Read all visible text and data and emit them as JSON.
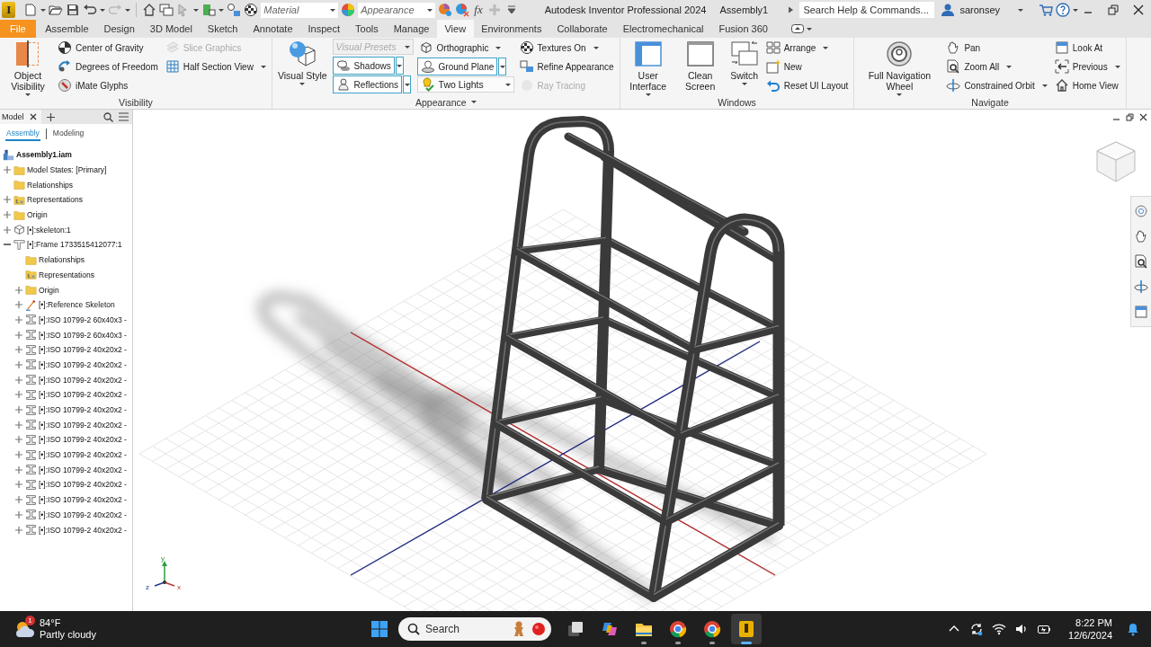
{
  "title_bar": {
    "app_letter": "I",
    "material": {
      "placeholder": "Material"
    },
    "appearance": {
      "placeholder": "Appearance"
    },
    "fx_label": "fx",
    "title": "Autodesk Inventor Professional 2024",
    "document": "Assembly1",
    "search": {
      "placeholder": "Search Help & Commands..."
    },
    "user": "saronsey"
  },
  "ribbon_tabs": [
    {
      "label": "File",
      "kind": "file",
      "selected": false
    },
    {
      "label": "Assemble",
      "kind": "tab",
      "selected": false
    },
    {
      "label": "Design",
      "kind": "tab",
      "selected": false
    },
    {
      "label": "3D Model",
      "kind": "tab",
      "selected": false
    },
    {
      "label": "Sketch",
      "kind": "tab",
      "selected": false
    },
    {
      "label": "Annotate",
      "kind": "tab",
      "selected": false
    },
    {
      "label": "Inspect",
      "kind": "tab",
      "selected": false
    },
    {
      "label": "Tools",
      "kind": "tab",
      "selected": false
    },
    {
      "label": "Manage",
      "kind": "tab",
      "selected": false
    },
    {
      "label": "View",
      "kind": "tab",
      "selected": true
    },
    {
      "label": "Environments",
      "kind": "tab",
      "selected": false
    },
    {
      "label": "Collaborate",
      "kind": "tab",
      "selected": false
    },
    {
      "label": "Electromechanical",
      "kind": "tab",
      "selected": false
    },
    {
      "label": "Fusion 360",
      "kind": "tab",
      "selected": false
    }
  ],
  "ribbon_panels": [
    {
      "title": "Visibility",
      "title_dropdown": false,
      "columns": [
        [
          {
            "label": "Object Visibility",
            "kind": "large",
            "dropdown": true,
            "disabled": false
          }
        ],
        [
          {
            "label": "Center of Gravity",
            "kind": "small",
            "dropdown": false,
            "disabled": false
          },
          {
            "label": "Degrees of Freedom",
            "kind": "small",
            "dropdown": false,
            "disabled": false
          },
          {
            "label": "iMate Glyphs",
            "kind": "small",
            "dropdown": false,
            "disabled": false
          }
        ],
        [
          {
            "label": "Slice Graphics",
            "kind": "small",
            "dropdown": false,
            "disabled": true
          },
          {
            "label": "Half Section View",
            "kind": "small",
            "dropdown": true,
            "disabled": false
          }
        ]
      ]
    },
    {
      "title": "Appearance",
      "title_dropdown": true,
      "columns": [
        [
          {
            "label": "Visual Style",
            "kind": "large",
            "dropdown": true,
            "disabled": false
          }
        ],
        [
          {
            "placeholder": "Visual Presets",
            "kind": "combo",
            "dropdown": true,
            "disabled": true
          },
          {
            "label": "Shadows",
            "kind": "split",
            "on": true,
            "dropdown": true,
            "disabled": false
          },
          {
            "label": "Reflections",
            "kind": "split",
            "on": true,
            "dropdown": true,
            "disabled": false
          }
        ],
        [
          {
            "label": "Orthographic",
            "kind": "small",
            "dropdown": true,
            "disabled": false
          },
          {
            "label": "Ground Plane",
            "kind": "split",
            "on": true,
            "dropdown": true,
            "disabled": false
          },
          {
            "value": "Two Lights",
            "kind": "combo",
            "dropdown": true,
            "disabled": false
          }
        ],
        [
          {
            "label": "Textures On",
            "kind": "small",
            "dropdown": true,
            "disabled": false
          },
          {
            "label": "Refine Appearance",
            "kind": "small",
            "dropdown": false,
            "disabled": false
          },
          {
            "label": "Ray Tracing",
            "kind": "small",
            "dropdown": false,
            "disabled": true
          }
        ]
      ]
    },
    {
      "title": "Windows",
      "title_dropdown": false,
      "columns": [
        [
          {
            "label": "User Interface",
            "kind": "large",
            "dropdown": true,
            "disabled": false
          }
        ],
        [
          {
            "label": "Clean Screen",
            "kind": "large",
            "dropdown": false,
            "disabled": false
          }
        ],
        [
          {
            "label": "Switch",
            "kind": "large",
            "dropdown": true,
            "disabled": false
          }
        ],
        [
          {
            "label": "Arrange",
            "kind": "small",
            "dropdown": true,
            "disabled": false
          },
          {
            "label": "New",
            "kind": "small",
            "dropdown": false,
            "disabled": false
          },
          {
            "label": "Reset UI Layout",
            "kind": "small",
            "dropdown": false,
            "disabled": false
          }
        ]
      ]
    },
    {
      "title": "Navigate",
      "title_dropdown": false,
      "columns": [
        [
          {
            "label": "Full Navigation Wheel",
            "kind": "large",
            "dropdown": true,
            "disabled": false
          }
        ],
        [
          {
            "label": "Pan",
            "kind": "small",
            "dropdown": false,
            "disabled": false
          },
          {
            "label": "Zoom All",
            "kind": "small",
            "dropdown": true,
            "disabled": false
          },
          {
            "label": "Constrained Orbit",
            "kind": "small",
            "dropdown": true,
            "disabled": false
          }
        ],
        [
          {
            "label": "Look At",
            "kind": "small",
            "dropdown": false,
            "disabled": false
          },
          {
            "label": "Previous",
            "kind": "small",
            "dropdown": true,
            "disabled": false
          },
          {
            "label": "Home View",
            "kind": "small",
            "dropdown": false,
            "disabled": false
          }
        ]
      ]
    }
  ],
  "browser": {
    "title": "Model",
    "tabs": [
      {
        "label": "Assembly",
        "selected": true
      },
      {
        "label": "Modeling",
        "selected": false
      }
    ],
    "root": {
      "label": "Assembly1.iam"
    },
    "items": [
      {
        "label": "Model States: [Primary]",
        "kind": "folder",
        "expanded": false
      },
      {
        "label": "Relationships",
        "kind": "folder"
      },
      {
        "label": "Representations",
        "kind": "rep",
        "expanded": false
      },
      {
        "label": "Origin",
        "kind": "folder",
        "expanded": false
      },
      {
        "label": "[•]:skeleton:1",
        "kind": "skeleton",
        "expanded": false
      },
      {
        "label": "[•]:Frame 1733515412077:1",
        "kind": "frame",
        "expanded": true,
        "children": [
          {
            "label": "Relationships",
            "kind": "folder"
          },
          {
            "label": "Representations",
            "kind": "rep"
          },
          {
            "label": "Origin",
            "kind": "folder",
            "expanded": false
          },
          {
            "label": "[•]:Reference Skeleton",
            "kind": "ref",
            "expanded": false
          },
          {
            "label": "[•]:ISO 10799-2 60x40x3 -",
            "kind": "part",
            "expanded": false
          },
          {
            "label": "[•]:ISO 10799-2 60x40x3 -",
            "kind": "part",
            "expanded": false
          },
          {
            "label": "[•]:ISO 10799-2 40x20x2 -",
            "kind": "part",
            "expanded": false
          },
          {
            "label": "[•]:ISO 10799-2 40x20x2 -",
            "kind": "part",
            "expanded": false
          },
          {
            "label": "[•]:ISO 10799-2 40x20x2 -",
            "kind": "part",
            "expanded": false
          },
          {
            "label": "[•]:ISO 10799-2 40x20x2 -",
            "kind": "part",
            "expanded": false
          },
          {
            "label": "[•]:ISO 10799-2 40x20x2 -",
            "kind": "part",
            "expanded": false
          },
          {
            "label": "[•]:ISO 10799-2 40x20x2 -",
            "kind": "part",
            "expanded": false
          },
          {
            "label": "[•]:ISO 10799-2 40x20x2 -",
            "kind": "part",
            "expanded": false
          },
          {
            "label": "[•]:ISO 10799-2 40x20x2 -",
            "kind": "part",
            "expanded": false
          },
          {
            "label": "[•]:ISO 10799-2 40x20x2 -",
            "kind": "part",
            "expanded": false
          },
          {
            "label": "[•]:ISO 10799-2 40x20x2 -",
            "kind": "part",
            "expanded": false
          },
          {
            "label": "[•]:ISO 10799-2 40x20x2 -",
            "kind": "part",
            "expanded": false
          },
          {
            "label": "[•]:ISO 10799-2 40x20x2 -",
            "kind": "part",
            "expanded": false
          },
          {
            "label": "[•]:ISO 10799-2 40x20x2 -",
            "kind": "part",
            "expanded": false
          }
        ]
      }
    ]
  },
  "viewport": {
    "triad": {
      "x": "x",
      "y": "y",
      "z": "z"
    }
  },
  "taskbar": {
    "weather": {
      "badge": "1",
      "temperature": "84°F",
      "condition": "Partly cloudy"
    },
    "search": {
      "placeholder": "Search"
    },
    "apps": [
      {
        "kind": "taskview",
        "running": false,
        "selected": false
      },
      {
        "kind": "copilot",
        "running": false,
        "selected": false
      },
      {
        "kind": "explorer",
        "running": true,
        "selected": false
      },
      {
        "kind": "browser",
        "running": true,
        "selected": false
      },
      {
        "kind": "browser",
        "running": true,
        "selected": false
      },
      {
        "kind": "inventor",
        "running": true,
        "selected": true
      }
    ],
    "clock": {
      "time": "8:22 PM",
      "date": "12/6/2024"
    }
  }
}
